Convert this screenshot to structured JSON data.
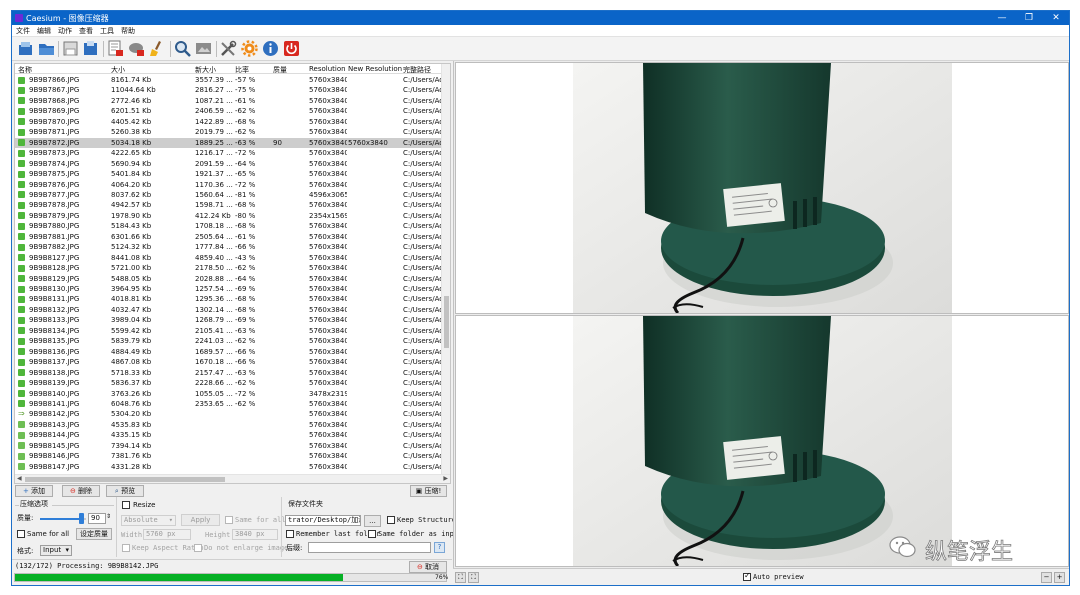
{
  "window": {
    "title": "Caesium - 图像压缩器",
    "minimize_glyph": "—",
    "maximize_glyph": "❐",
    "close_glyph": "✕"
  },
  "menu": [
    "文件",
    "编辑",
    "动作",
    "查看",
    "工具",
    "帮助"
  ],
  "toolbar": {
    "icons": [
      "add-files-icon",
      "open-folder-icon",
      "save-icon",
      "export-icon",
      "remove-item-icon",
      "remove-all-icon",
      "clear-list-icon",
      "preview-zoom-icon",
      "compare-icon",
      "tools-icon",
      "settings-gear-icon",
      "about-info-icon",
      "exit-power-icon"
    ],
    "colors": {
      "blue": "#2f6fbf",
      "red": "#d8281f",
      "orange": "#f08c1a"
    }
  },
  "list": {
    "columns": [
      "名称",
      "大小",
      "新大小",
      "比率",
      "质量",
      "Resolution",
      "New Resolution",
      "完整路径"
    ],
    "selected_index": 6,
    "rows": [
      {
        "name": "9B9B7866.JPG",
        "size": "8161.74 Kb",
        "new_size": "3557.39 ...",
        "ratio": "-57 %",
        "quality": "",
        "res": "5760x3840",
        "new_res": "",
        "path": "C:/Users/Adr",
        "state": "done"
      },
      {
        "name": "9B9B7867.JPG",
        "size": "11044.64 Kb",
        "new_size": "2816.27 ...",
        "ratio": "-75 %",
        "quality": "",
        "res": "5760x3840",
        "new_res": "",
        "path": "C:/Users/Adr",
        "state": "done"
      },
      {
        "name": "9B9B7868.JPG",
        "size": "2772.46 Kb",
        "new_size": "1087.21 ...",
        "ratio": "-61 %",
        "quality": "",
        "res": "5760x3840",
        "new_res": "",
        "path": "C:/Users/Adr",
        "state": "done"
      },
      {
        "name": "9B9B7869.JPG",
        "size": "6201.51 Kb",
        "new_size": "2406.59 ...",
        "ratio": "-62 %",
        "quality": "",
        "res": "5760x3840",
        "new_res": "",
        "path": "C:/Users/Adr",
        "state": "done"
      },
      {
        "name": "9B9B7870.JPG",
        "size": "4405.42 Kb",
        "new_size": "1422.89 ...",
        "ratio": "-68 %",
        "quality": "",
        "res": "5760x3840",
        "new_res": "",
        "path": "C:/Users/Adr",
        "state": "done"
      },
      {
        "name": "9B9B7871.JPG",
        "size": "5260.38 Kb",
        "new_size": "2019.79 ...",
        "ratio": "-62 %",
        "quality": "",
        "res": "5760x3840",
        "new_res": "",
        "path": "C:/Users/Adr",
        "state": "done"
      },
      {
        "name": "9B9B7872.JPG",
        "size": "5034.18 Kb",
        "new_size": "1889.25 ...",
        "ratio": "-63 %",
        "quality": "90",
        "res": "5760x3840",
        "new_res": "5760x3840",
        "path": "C:/Users/Adr",
        "state": "done"
      },
      {
        "name": "9B9B7873.JPG",
        "size": "4222.65 Kb",
        "new_size": "1216.17 ...",
        "ratio": "-72 %",
        "quality": "",
        "res": "5760x3840",
        "new_res": "",
        "path": "C:/Users/Adr",
        "state": "done"
      },
      {
        "name": "9B9B7874.JPG",
        "size": "5690.94 Kb",
        "new_size": "2091.59 ...",
        "ratio": "-64 %",
        "quality": "",
        "res": "5760x3840",
        "new_res": "",
        "path": "C:/Users/Adr",
        "state": "done"
      },
      {
        "name": "9B9B7875.JPG",
        "size": "5401.84 Kb",
        "new_size": "1921.37 ...",
        "ratio": "-65 %",
        "quality": "",
        "res": "5760x3840",
        "new_res": "",
        "path": "C:/Users/Adr",
        "state": "done"
      },
      {
        "name": "9B9B7876.JPG",
        "size": "4064.20 Kb",
        "new_size": "1170.36 ...",
        "ratio": "-72 %",
        "quality": "",
        "res": "5760x3840",
        "new_res": "",
        "path": "C:/Users/Adr",
        "state": "done"
      },
      {
        "name": "9B9B7877.JPG",
        "size": "8037.62 Kb",
        "new_size": "1560.64 ...",
        "ratio": "-81 %",
        "quality": "",
        "res": "4596x3065",
        "new_res": "",
        "path": "C:/Users/Adr",
        "state": "done"
      },
      {
        "name": "9B9B7878.JPG",
        "size": "4942.57 Kb",
        "new_size": "1598.71 ...",
        "ratio": "-68 %",
        "quality": "",
        "res": "5760x3840",
        "new_res": "",
        "path": "C:/Users/Adr",
        "state": "done"
      },
      {
        "name": "9B9B7879.JPG",
        "size": "1978.90 Kb",
        "new_size": "412.24 Kb",
        "ratio": "-80 %",
        "quality": "",
        "res": "2354x1569",
        "new_res": "",
        "path": "C:/Users/Adr",
        "state": "done"
      },
      {
        "name": "9B9B7880.JPG",
        "size": "5184.43 Kb",
        "new_size": "1708.18 ...",
        "ratio": "-68 %",
        "quality": "",
        "res": "5760x3840",
        "new_res": "",
        "path": "C:/Users/Adr",
        "state": "done"
      },
      {
        "name": "9B9B7881.JPG",
        "size": "6301.66 Kb",
        "new_size": "2505.64 ...",
        "ratio": "-61 %",
        "quality": "",
        "res": "5760x3840",
        "new_res": "",
        "path": "C:/Users/Adr",
        "state": "done"
      },
      {
        "name": "9B9B7882.JPG",
        "size": "5124.32 Kb",
        "new_size": "1777.84 ...",
        "ratio": "-66 %",
        "quality": "",
        "res": "5760x3840",
        "new_res": "",
        "path": "C:/Users/Adr",
        "state": "done"
      },
      {
        "name": "9B9B8127.JPG",
        "size": "8441.08 Kb",
        "new_size": "4859.40 ...",
        "ratio": "-43 %",
        "quality": "",
        "res": "5760x3840",
        "new_res": "",
        "path": "C:/Users/Adr",
        "state": "done"
      },
      {
        "name": "9B9B8128.JPG",
        "size": "5721.00 Kb",
        "new_size": "2178.50 ...",
        "ratio": "-62 %",
        "quality": "",
        "res": "5760x3840",
        "new_res": "",
        "path": "C:/Users/Adr",
        "state": "done"
      },
      {
        "name": "9B9B8129.JPG",
        "size": "5488.05 Kb",
        "new_size": "2028.88 ...",
        "ratio": "-64 %",
        "quality": "",
        "res": "5760x3840",
        "new_res": "",
        "path": "C:/Users/Adr",
        "state": "done"
      },
      {
        "name": "9B9B8130.JPG",
        "size": "3964.95 Kb",
        "new_size": "1257.54 ...",
        "ratio": "-69 %",
        "quality": "",
        "res": "5760x3840",
        "new_res": "",
        "path": "C:/Users/Adr",
        "state": "done"
      },
      {
        "name": "9B9B8131.JPG",
        "size": "4018.81 Kb",
        "new_size": "1295.36 ...",
        "ratio": "-68 %",
        "quality": "",
        "res": "5760x3840",
        "new_res": "",
        "path": "C:/Users/Adr",
        "state": "done"
      },
      {
        "name": "9B9B8132.JPG",
        "size": "4032.47 Kb",
        "new_size": "1302.14 ...",
        "ratio": "-68 %",
        "quality": "",
        "res": "5760x3840",
        "new_res": "",
        "path": "C:/Users/Adr",
        "state": "done"
      },
      {
        "name": "9B9B8133.JPG",
        "size": "3989.04 Kb",
        "new_size": "1268.79 ...",
        "ratio": "-69 %",
        "quality": "",
        "res": "5760x3840",
        "new_res": "",
        "path": "C:/Users/Adr",
        "state": "done"
      },
      {
        "name": "9B9B8134.JPG",
        "size": "5599.42 Kb",
        "new_size": "2105.41 ...",
        "ratio": "-63 %",
        "quality": "",
        "res": "5760x3840",
        "new_res": "",
        "path": "C:/Users/Adr",
        "state": "done"
      },
      {
        "name": "9B9B8135.JPG",
        "size": "5839.79 Kb",
        "new_size": "2241.03 ...",
        "ratio": "-62 %",
        "quality": "",
        "res": "5760x3840",
        "new_res": "",
        "path": "C:/Users/Adr",
        "state": "done"
      },
      {
        "name": "9B9B8136.JPG",
        "size": "4884.49 Kb",
        "new_size": "1689.57 ...",
        "ratio": "-66 %",
        "quality": "",
        "res": "5760x3840",
        "new_res": "",
        "path": "C:/Users/Adr",
        "state": "done"
      },
      {
        "name": "9B9B8137.JPG",
        "size": "4867.08 Kb",
        "new_size": "1670.18 ...",
        "ratio": "-66 %",
        "quality": "",
        "res": "5760x3840",
        "new_res": "",
        "path": "C:/Users/Adr",
        "state": "done"
      },
      {
        "name": "9B9B8138.JPG",
        "size": "5718.33 Kb",
        "new_size": "2157.47 ...",
        "ratio": "-63 %",
        "quality": "",
        "res": "5760x3840",
        "new_res": "",
        "path": "C:/Users/Adr",
        "state": "done"
      },
      {
        "name": "9B9B8139.JPG",
        "size": "5836.37 Kb",
        "new_size": "2228.66 ...",
        "ratio": "-62 %",
        "quality": "",
        "res": "5760x3840",
        "new_res": "",
        "path": "C:/Users/Adr",
        "state": "done"
      },
      {
        "name": "9B9B8140.JPG",
        "size": "3763.26 Kb",
        "new_size": "1055.05 ...",
        "ratio": "-72 %",
        "quality": "",
        "res": "3478x2319",
        "new_res": "",
        "path": "C:/Users/Adr",
        "state": "done"
      },
      {
        "name": "9B9B8141.JPG",
        "size": "6048.76 Kb",
        "new_size": "2353.65 ...",
        "ratio": "-62 %",
        "quality": "",
        "res": "5760x3840",
        "new_res": "",
        "path": "C:/Users/Adr",
        "state": "done"
      },
      {
        "name": "9B9B8142.JPG",
        "size": "5304.20 Kb",
        "new_size": "",
        "ratio": "",
        "quality": "",
        "res": "5760x3840",
        "new_res": "",
        "path": "C:/Users/Adr",
        "state": "current"
      },
      {
        "name": "9B9B8143.JPG",
        "size": "4535.83 Kb",
        "new_size": "",
        "ratio": "",
        "quality": "",
        "res": "5760x3840",
        "new_res": "",
        "path": "C:/Users/Adr",
        "state": "pending"
      },
      {
        "name": "9B9B8144.JPG",
        "size": "4335.15 Kb",
        "new_size": "",
        "ratio": "",
        "quality": "",
        "res": "5760x3840",
        "new_res": "",
        "path": "C:/Users/Adr",
        "state": "pending"
      },
      {
        "name": "9B9B8145.JPG",
        "size": "7394.14 Kb",
        "new_size": "",
        "ratio": "",
        "quality": "",
        "res": "5760x3840",
        "new_res": "",
        "path": "C:/Users/Adr",
        "state": "pending"
      },
      {
        "name": "9B9B8146.JPG",
        "size": "7381.76 Kb",
        "new_size": "",
        "ratio": "",
        "quality": "",
        "res": "5760x3840",
        "new_res": "",
        "path": "C:/Users/Adr",
        "state": "pending"
      },
      {
        "name": "9B9B8147.JPG",
        "size": "4331.28 Kb",
        "new_size": "",
        "ratio": "",
        "quality": "",
        "res": "5760x3840",
        "new_res": "",
        "path": "C:/Users/Adr v",
        "state": "pending"
      }
    ]
  },
  "list_actions": {
    "add": "添加",
    "remove": "删除",
    "preview": "预览",
    "compress": "压缩!"
  },
  "compression": {
    "section_title": "压缩选项",
    "quality_label": "质量:",
    "quality_value": "90",
    "quality_percent": 90,
    "same_for_all": "Same for all",
    "set_quality": "设定质量",
    "format_label": "格式:",
    "format_value": "Input"
  },
  "resize": {
    "label": "Resize",
    "mode": "Absolute",
    "apply": "Apply",
    "same_for_all": "Same for all",
    "width_label": "Width",
    "width_value": "5760 px",
    "height_label": "Height",
    "height_value": "3840 px",
    "keep_aspect": "Keep Aspect Ratio",
    "no_enlarge": "Do not enlarge images"
  },
  "output": {
    "section_title": "保存文件夹",
    "folder_value": "trator/Desktop/加湿器",
    "browse": "...",
    "keep_structure": "Keep Structure",
    "remember_last": "Remember last folder",
    "same_folder": "Same folder as input",
    "suffix_label": "后缀:",
    "suffix_value": ""
  },
  "status": {
    "processing_text": "(132/172) Processing: 9B9B8142.JPG",
    "cancel": "取消",
    "progress_text": "76%",
    "progress_percent": 76
  },
  "preview": {
    "auto_preview_label": "Auto preview",
    "auto_preview_checked": true,
    "product_colors": {
      "body": "#1e4b3c",
      "base": "#23584a",
      "label": "#eceee9"
    }
  },
  "watermark": {
    "text": "纵笔浮生"
  }
}
